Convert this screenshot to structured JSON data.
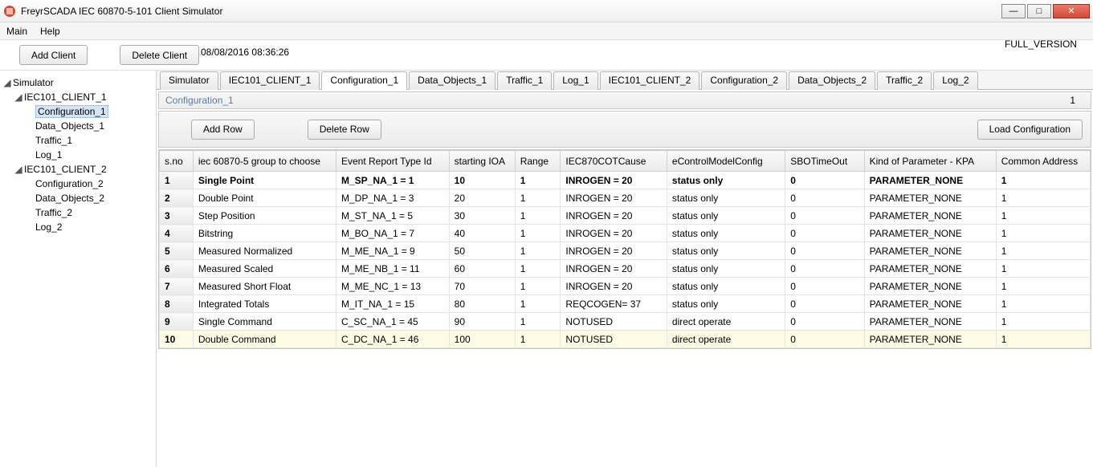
{
  "window": {
    "title": "FreyrSCADA IEC 60870-5-101 Client Simulator"
  },
  "menubar": {
    "main": "Main",
    "help": "Help"
  },
  "toolbar": {
    "add_client": "Add Client",
    "delete_client": "Delete Client",
    "timestamp": "08/08/2016 08:36:26",
    "version": "FULL_VERSION"
  },
  "tree": {
    "root": "Simulator",
    "c1": {
      "name": "IEC101_CLIENT_1",
      "cfg": "Configuration_1",
      "data": "Data_Objects_1",
      "traffic": "Traffic_1",
      "log": "Log_1"
    },
    "c2": {
      "name": "IEC101_CLIENT_2",
      "cfg": "Configuration_2",
      "data": "Data_Objects_2",
      "traffic": "Traffic_2",
      "log": "Log_2"
    }
  },
  "tabs": {
    "t0": "Simulator",
    "t1": "IEC101_CLIENT_1",
    "t2": "Configuration_1",
    "t3": "Data_Objects_1",
    "t4": "Traffic_1",
    "t5": "Log_1",
    "t6": "IEC101_CLIENT_2",
    "t7": "Configuration_2",
    "t8": "Data_Objects_2",
    "t9": "Traffic_2",
    "t10": "Log_2"
  },
  "section": {
    "title": "Configuration_1",
    "row_count": "1"
  },
  "cfg_buttons": {
    "add": "Add Row",
    "del": "Delete Row",
    "load": "Load Configuration"
  },
  "headers": {
    "sno": "s.no",
    "group": "iec 60870-5 group to choose",
    "ert": "Event Report Type Id",
    "ioa": "starting IOA",
    "range": "Range",
    "cot": "IEC870COTCause",
    "ecmc": "eControlModelConfig",
    "sbo": "SBOTimeOut",
    "kpa": "Kind of Parameter - KPA",
    "ca": "Common Address"
  },
  "rows": [
    {
      "sno": "1",
      "group": "Single Point",
      "ert": "M_SP_NA_1 = 1",
      "ioa": "10",
      "range": "1",
      "cot": "INROGEN = 20",
      "ecmc": "status only",
      "sbo": "0",
      "kpa": "PARAMETER_NONE",
      "ca": "1"
    },
    {
      "sno": "2",
      "group": "Double Point",
      "ert": "M_DP_NA_1 = 3",
      "ioa": "20",
      "range": "1",
      "cot": "INROGEN = 20",
      "ecmc": "status only",
      "sbo": "0",
      "kpa": "PARAMETER_NONE",
      "ca": "1"
    },
    {
      "sno": "3",
      "group": "Step Position",
      "ert": "M_ST_NA_1 = 5",
      "ioa": "30",
      "range": "1",
      "cot": "INROGEN = 20",
      "ecmc": "status only",
      "sbo": "0",
      "kpa": "PARAMETER_NONE",
      "ca": "1"
    },
    {
      "sno": "4",
      "group": "Bitstring",
      "ert": "M_BO_NA_1 = 7",
      "ioa": "40",
      "range": "1",
      "cot": "INROGEN = 20",
      "ecmc": "status only",
      "sbo": "0",
      "kpa": "PARAMETER_NONE",
      "ca": "1"
    },
    {
      "sno": "5",
      "group": "Measured Normalized",
      "ert": "M_ME_NA_1 = 9",
      "ioa": "50",
      "range": "1",
      "cot": "INROGEN = 20",
      "ecmc": "status only",
      "sbo": "0",
      "kpa": "PARAMETER_NONE",
      "ca": "1"
    },
    {
      "sno": "6",
      "group": "Measured Scaled",
      "ert": "M_ME_NB_1 = 11",
      "ioa": "60",
      "range": "1",
      "cot": "INROGEN = 20",
      "ecmc": "status only",
      "sbo": "0",
      "kpa": "PARAMETER_NONE",
      "ca": "1"
    },
    {
      "sno": "7",
      "group": "Measured Short Float",
      "ert": "M_ME_NC_1 = 13",
      "ioa": "70",
      "range": "1",
      "cot": "INROGEN = 20",
      "ecmc": "status only",
      "sbo": "0",
      "kpa": "PARAMETER_NONE",
      "ca": "1"
    },
    {
      "sno": "8",
      "group": "Integrated Totals",
      "ert": "M_IT_NA_1 = 15",
      "ioa": "80",
      "range": "1",
      "cot": "REQCOGEN= 37",
      "ecmc": "status only",
      "sbo": "0",
      "kpa": "PARAMETER_NONE",
      "ca": "1"
    },
    {
      "sno": "9",
      "group": "Single Command",
      "ert": "C_SC_NA_1 = 45",
      "ioa": "90",
      "range": "1",
      "cot": "NOTUSED",
      "ecmc": "direct operate",
      "sbo": "0",
      "kpa": "PARAMETER_NONE",
      "ca": "1"
    },
    {
      "sno": "10",
      "group": "Double Command",
      "ert": "C_DC_NA_1 = 46",
      "ioa": "100",
      "range": "1",
      "cot": "NOTUSED",
      "ecmc": "direct operate",
      "sbo": "0",
      "kpa": "PARAMETER_NONE",
      "ca": "1"
    }
  ]
}
